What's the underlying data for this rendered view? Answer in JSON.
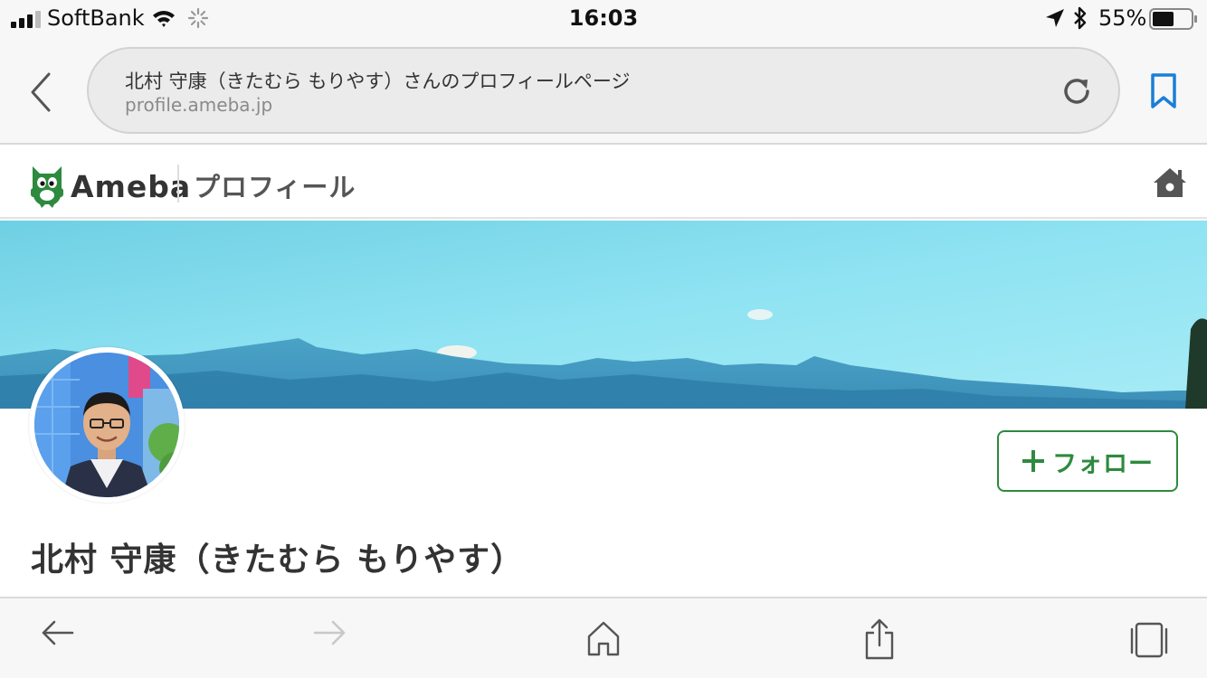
{
  "status_bar": {
    "carrier": "SoftBank",
    "time": "16:03",
    "battery_percent": "55%",
    "battery_level": 0.55,
    "icons": [
      "signal-icon",
      "wifi-icon",
      "loading-spinner-icon",
      "location-arrow-icon",
      "bluetooth-icon",
      "battery-icon"
    ]
  },
  "address_bar": {
    "page_title": "北村 守康（きたむら もりやす）さんのプロフィールページ",
    "domain": "profile.ameba.jp",
    "icons": [
      "back-chevron-icon",
      "reload-icon",
      "bookmark-icon"
    ]
  },
  "header": {
    "brand": "Ameba",
    "section": "プロフィール",
    "brand_color": "#2d8a3e",
    "icons": [
      "ameba-mascot-icon",
      "home-icon"
    ]
  },
  "profile": {
    "name": "北村 守康（きたむら もりやす）",
    "follow_label": "フォロー",
    "follow_color": "#2d8a3e"
  },
  "toolbar": {
    "icons": [
      "back-arrow-icon",
      "forward-arrow-icon",
      "home-icon",
      "share-icon",
      "tabs-icon"
    ]
  }
}
